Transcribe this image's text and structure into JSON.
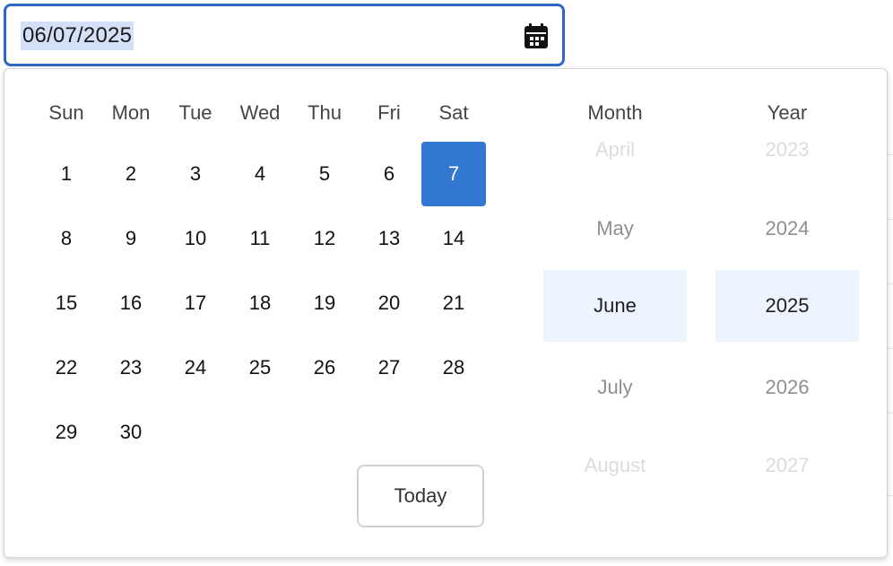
{
  "date_input": {
    "value": "06/07/2025",
    "icon": "calendar-icon"
  },
  "calendar": {
    "weekdays": [
      "Sun",
      "Mon",
      "Tue",
      "Wed",
      "Thu",
      "Fri",
      "Sat"
    ],
    "selected_day": "7",
    "weeks": [
      [
        "",
        "",
        "",
        "",
        "",
        "",
        "7"
      ],
      [
        "8",
        "9",
        "10",
        "11",
        "12",
        "13",
        "14"
      ],
      [
        "15",
        "16",
        "17",
        "18",
        "19",
        "20",
        "21"
      ],
      [
        "22",
        "23",
        "24",
        "25",
        "26",
        "27",
        "28"
      ],
      [
        "29",
        "30",
        "",
        "",
        "",
        "",
        ""
      ]
    ],
    "first_row": [
      "1",
      "2",
      "3",
      "4",
      "5",
      "6",
      "7"
    ],
    "today_label": "Today"
  },
  "month_wheel": {
    "header": "Month",
    "items": [
      "April",
      "May",
      "June",
      "July",
      "August"
    ],
    "selected": "June"
  },
  "year_wheel": {
    "header": "Year",
    "items": [
      "2023",
      "2024",
      "2025",
      "2026",
      "2027"
    ],
    "selected": "2025"
  },
  "colors": {
    "accent": "#3277d1",
    "input_border": "#3066c2",
    "selection_highlight": "#d4dff8",
    "wheel_selected_bg": "#eef4fe"
  }
}
